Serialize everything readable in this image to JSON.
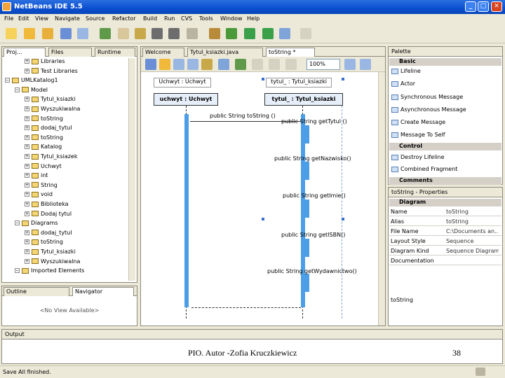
{
  "window": {
    "title": "NetBeans IDE 5.5",
    "min": "_",
    "max": "□",
    "close": "✕"
  },
  "menu": [
    "File",
    "Edit",
    "View",
    "Navigate",
    "Source",
    "Refactor",
    "Build",
    "Run",
    "CVS",
    "Tools",
    "Window",
    "Help"
  ],
  "left_tabs": [
    "Proj...",
    "Files",
    "Runtime"
  ],
  "tree": [
    {
      "label": "Libraries",
      "indent": 2
    },
    {
      "label": "Test Libraries",
      "indent": 2
    },
    {
      "label": "UMLKatalog1",
      "indent": 0
    },
    {
      "label": "Model",
      "indent": 1
    },
    {
      "label": "Tytul_ksiazki",
      "indent": 2
    },
    {
      "label": "Wyszukiwalna",
      "indent": 2
    },
    {
      "label": "toString",
      "indent": 2
    },
    {
      "label": "dodaj_tytul",
      "indent": 2
    },
    {
      "label": "toString",
      "indent": 2
    },
    {
      "label": "Katalog",
      "indent": 2
    },
    {
      "label": "Tytul_ksiazek",
      "indent": 2
    },
    {
      "label": "Uchwyt",
      "indent": 2
    },
    {
      "label": "int",
      "indent": 2
    },
    {
      "label": "String",
      "indent": 2
    },
    {
      "label": "void",
      "indent": 2
    },
    {
      "label": "Biblioteka",
      "indent": 2
    },
    {
      "label": "Dodaj tytul",
      "indent": 2
    },
    {
      "label": "Diagrams",
      "indent": 1
    },
    {
      "label": "dodaj_tytul",
      "indent": 2
    },
    {
      "label": "toString",
      "indent": 2
    },
    {
      "label": "Tytul_ksiazki",
      "indent": 2
    },
    {
      "label": "Wyszukiwalna",
      "indent": 2
    },
    {
      "label": "Imported Elements",
      "indent": 1
    }
  ],
  "outline": {
    "tab1": "Outline",
    "tab2": "Navigator",
    "empty": "<No View Available>"
  },
  "editor_tabs": [
    "Welcome",
    "Tytul_ksiazki.java",
    "toString *"
  ],
  "editor_toolbar": {
    "zoom": "100%"
  },
  "diagram": {
    "lifeline_left_label": "Uchwyt : Uchwyt",
    "lifeline_right_label": "tytul_ : Tytul_ksiazki",
    "obj_left": "uchwyt : Uchwyt",
    "obj_right": "tytul_ : Tytul_ksiazki",
    "messages": [
      "public String toString ()",
      "public String getTytul ()",
      "public String getNazwisko()",
      "public String getImie()",
      "public String getISBN()",
      "public String getWydawnictwo()"
    ]
  },
  "palette": {
    "title": "Palette",
    "basic": "Basic",
    "basic_items": [
      "Lifeline",
      "Actor",
      "Synchronous Message",
      "Asynchronous Message",
      "Create Message",
      "Message To Self"
    ],
    "control": "Control",
    "control_items": [
      "Destroy Lifeline",
      "Combined Fragment"
    ],
    "comments": "Comments"
  },
  "properties": {
    "title": "toString - Properties",
    "section": "Diagram",
    "rows": [
      {
        "k": "Name",
        "v": "toString"
      },
      {
        "k": "Alias",
        "v": "toString"
      },
      {
        "k": "File Name",
        "v": "C:\\Documents an..."
      },
      {
        "k": "Layout Style",
        "v": "Sequence"
      },
      {
        "k": "Diagram Kind",
        "v": "Sequence Diagram"
      },
      {
        "k": "Documentation",
        "v": ""
      }
    ],
    "footer": "toString"
  },
  "output": {
    "title": "Output"
  },
  "status": {
    "text": "Save All finished."
  },
  "slide_footer": {
    "author": "PIO. Autor -Zofia Kruczkiewicz",
    "page": "38"
  },
  "colors": {
    "accent": "#4c9fe6",
    "titlebar": "#0a4fd0"
  }
}
